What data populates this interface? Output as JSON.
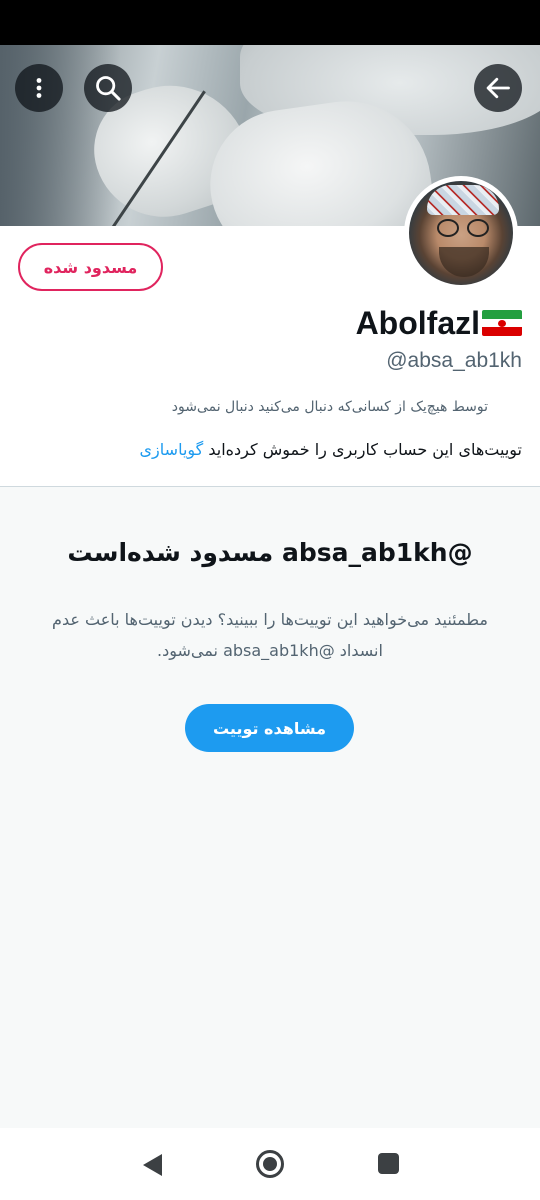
{
  "profile": {
    "blocked_label": "مسدود شده",
    "display_name": "Abolfazl",
    "handle": "@absa_ab1kh",
    "followers_note": "توسط هیچ‌یک از کسانی‌که دنبال می‌کنید دنبال نمی‌شود",
    "muted_text": "توییت‌های این حساب کاربری را خموش کرده‌اید",
    "muted_link": "گویاسازی"
  },
  "blocked_notice": {
    "title": "@absa_ab1kh مسدود شده‌است",
    "description": "مطمئنید می‌خواهید این توییت‌ها را ببینید؟ دیدن توییت‌ها باعث عدم انسداد @absa_ab1kh نمی‌شود.",
    "view_button": "مشاهده توییت"
  },
  "colors": {
    "accent": "#1d9bf0",
    "blocked_red": "#e0245e",
    "text_primary": "#0f1419",
    "text_secondary": "#536471"
  },
  "icons": {
    "back": "arrow-left-icon",
    "search": "search-icon",
    "more": "more-vertical-icon",
    "flag": "iran-flag-icon",
    "nav_back": "triangle-back-icon",
    "nav_home": "circle-home-icon",
    "nav_recent": "square-recent-icon"
  }
}
